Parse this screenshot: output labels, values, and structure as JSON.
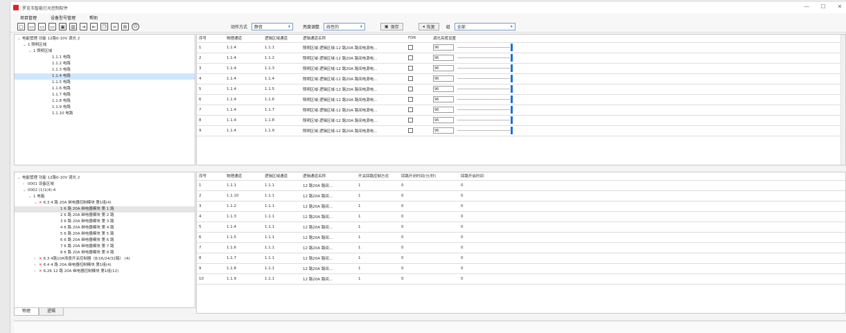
{
  "window": {
    "title": "罗克韦智能灯光控制软件",
    "controls": [
      "—",
      "☐",
      "✕"
    ]
  },
  "menu": [
    "项目管理",
    "设备型号管理",
    "帮助"
  ],
  "toolbar": {
    "icons": [
      "new-file-icon",
      "open-folder-icon",
      "folder-icon",
      "folder-add-icon",
      "save-icon",
      "delete-icon",
      "import-icon",
      "export-icon",
      "copy-icon",
      "link-icon",
      "grid-icon",
      "power-icon"
    ],
    "action_mode_label": "动作方式",
    "action_mode_value": "静音",
    "brightness_label": "亮度调整",
    "brightness_value": "线性的",
    "save_label": "保存",
    "restore_label": "恢复",
    "filter_label": "组",
    "filter_value": "全部"
  },
  "top_tree": {
    "root": "电能管理 功能 12路0-10V 调光 2",
    "area": "1 照明区域",
    "sub": "1 照明区域",
    "items": [
      "1.1.1 电路",
      "1.1.2 电路",
      "1.1.3 电路",
      "1.1.4 电路",
      "1.1.5 电路",
      "1.1.6 电路",
      "1.1.7 电路",
      "1.1.8 电路",
      "1.1.9 电路",
      "1.1.10 电路"
    ],
    "selected_index": 3
  },
  "top_table": {
    "headers": [
      "序号",
      "物理通道",
      "逻辑区域通道",
      "逻辑通道名称",
      "FDR",
      "调光亮度设置"
    ],
    "rows": [
      {
        "idx": "1",
        "phys": "1.1.4",
        "logic": "1.1.1",
        "name": "照明区域-逻辑区域-12 路20A 路间电源电...",
        "val": "96"
      },
      {
        "idx": "2",
        "phys": "1.1.4",
        "logic": "1.1.2",
        "name": "照明区域-逻辑区域-12 路20A 路间电源电...",
        "val": "96"
      },
      {
        "idx": "3",
        "phys": "1.1.4",
        "logic": "1.1.3",
        "name": "照明区域-逻辑区域-12 路20A 路间电源电...",
        "val": "96"
      },
      {
        "idx": "4",
        "phys": "1.1.4",
        "logic": "1.1.4",
        "name": "照明区域-逻辑区域-12 路20A 路间电源电...",
        "val": "96"
      },
      {
        "idx": "5",
        "phys": "1.1.4",
        "logic": "1.1.5",
        "name": "照明区域-逻辑区域-12 路20A 路间电源电...",
        "val": "96"
      },
      {
        "idx": "6",
        "phys": "1.1.4",
        "logic": "1.1.6",
        "name": "照明区域-逻辑区域-12 路20A 路间电源电...",
        "val": "96"
      },
      {
        "idx": "7",
        "phys": "1.1.4",
        "logic": "1.1.7",
        "name": "照明区域-逻辑区域-12 路20A 路间电源电...",
        "val": "96"
      },
      {
        "idx": "8",
        "phys": "1.1.4",
        "logic": "1.1.8",
        "name": "照明区域-逻辑区域-12 路20A 路间电源电...",
        "val": "96"
      },
      {
        "idx": "9",
        "phys": "1.1.4",
        "logic": "1.1.9",
        "name": "照明区域-逻辑区域-12 路20A 路间电源电...",
        "val": "96"
      }
    ]
  },
  "bottom_tree": {
    "root": "电能管理 功能 12路0-10V 调光 2",
    "n1": "0001 设备区域",
    "n2": "0002 (1)1(4)-4",
    "n3": "1 电箱",
    "group1": "6.3 4 路 20A 继电器控制模块 第1组(4)",
    "subitems": [
      "1 6 路 20A 继电器模块 第 1 路",
      "2 6 路 20A 继电器模块 第 2 路",
      "3 6 路 20A 继电器模块 第 3 路",
      "4 6 路 20A 继电器模块 第 4 路",
      "5 6 路 20A 继电器模块 第 5 路",
      "6 6 路 20A 继电器模块 第 6 路",
      "7 6 路 20A 继电器模块 第 7 路",
      "8 6 路 20A 继电器模块 第 8 路"
    ],
    "group2": "6.3 4路10A场景开关控制器（8/16/24/32路） (4)",
    "group3": "6.4 4 路 20A 继电器控制模块 第1组(4)",
    "group4": "6.26 12 路 20A 继电器控制模块 第1组(12)"
  },
  "bottom_table": {
    "headers": [
      "序号",
      "物理通道",
      "逻辑区域通道",
      "逻辑通道名称",
      "开关回路控制方式",
      "回路开闭时间(分/秒)",
      "回路开启时间"
    ],
    "rows": [
      {
        "idx": "1",
        "phys": "1.1.1",
        "logic": "1.1.1",
        "name": "12 路20A 路间...",
        "mode": "1",
        "t1": "0",
        "t2": "0"
      },
      {
        "idx": "2",
        "phys": "1.1.10",
        "logic": "1.1.1",
        "name": "12 路20A 路间...",
        "mode": "1",
        "t1": "0",
        "t2": "0"
      },
      {
        "idx": "3",
        "phys": "1.1.2",
        "logic": "1.1.1",
        "name": "12 路20A 路间...",
        "mode": "1",
        "t1": "0",
        "t2": "0"
      },
      {
        "idx": "4",
        "phys": "1.1.3",
        "logic": "1.1.1",
        "name": "12 路20A 路间...",
        "mode": "1",
        "t1": "0",
        "t2": "0"
      },
      {
        "idx": "5",
        "phys": "1.1.4",
        "logic": "1.1.1",
        "name": "12 路20A 路间...",
        "mode": "1",
        "t1": "0",
        "t2": "0"
      },
      {
        "idx": "6",
        "phys": "1.1.5",
        "logic": "1.1.1",
        "name": "12 路20A 路间...",
        "mode": "1",
        "t1": "0",
        "t2": "0"
      },
      {
        "idx": "7",
        "phys": "1.1.6",
        "logic": "1.1.1",
        "name": "12 路20A 路间...",
        "mode": "1",
        "t1": "0",
        "t2": "0"
      },
      {
        "idx": "8",
        "phys": "1.1.7",
        "logic": "1.1.1",
        "name": "12 路20A 路间...",
        "mode": "1",
        "t1": "0",
        "t2": "0"
      },
      {
        "idx": "9",
        "phys": "1.1.8",
        "logic": "1.1.1",
        "name": "12 路20A 路间...",
        "mode": "1",
        "t1": "0",
        "t2": "0"
      },
      {
        "idx": "10",
        "phys": "1.1.9",
        "logic": "1.1.1",
        "name": "12 路20A 路间...",
        "mode": "1",
        "t1": "0",
        "t2": "0"
      }
    ]
  },
  "bottom_tabs": [
    "物理",
    "逻辑"
  ],
  "colors": {
    "accent": "#1a6fe0",
    "brand": "#d9262b",
    "error": "#d42020"
  }
}
